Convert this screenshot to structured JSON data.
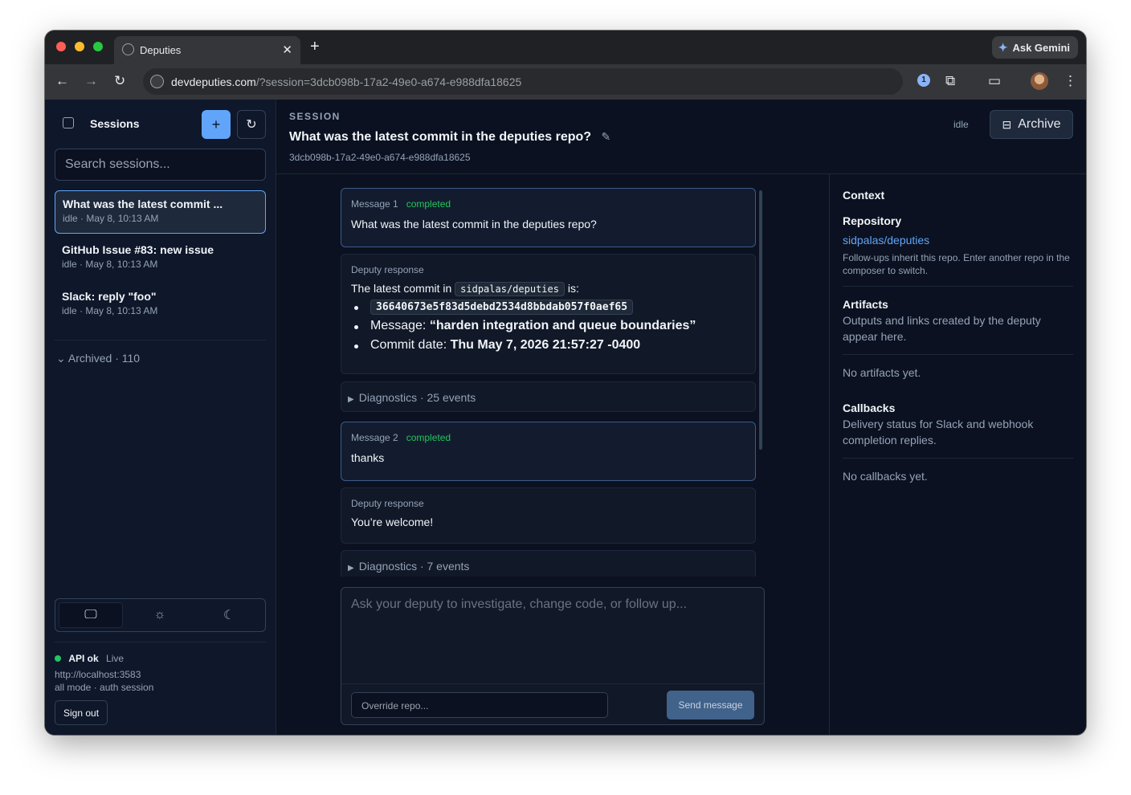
{
  "browser": {
    "tab_title": "Deputies",
    "gemini_label": "Ask Gemini",
    "url_host": "devdeputies.com",
    "url_path": "/?session=3dcb098b-17a2-49e0-a674-e988dfa18625"
  },
  "sidebar": {
    "title": "Sessions",
    "search_placeholder": "Search sessions...",
    "sessions": [
      {
        "title": "What was the latest commit ...",
        "meta": "idle · May 8, 10:13 AM"
      },
      {
        "title": "GitHub Issue #83: new issue",
        "meta": "idle · May 8, 10:13 AM"
      },
      {
        "title": "Slack: reply \"foo\"",
        "meta": "idle · May 8, 10:13 AM"
      }
    ],
    "archived": "Archived · 110",
    "api_status": "API ok",
    "api_live": "Live",
    "api_url": "http://localhost:3583",
    "mode": "all mode · auth session",
    "sign_out": "Sign out"
  },
  "header": {
    "eyebrow": "SESSION",
    "title": "What was the latest commit in the deputies repo?",
    "session_id": "3dcb098b-17a2-49e0-a674-e988dfa18625",
    "status": "idle",
    "archive": "Archive"
  },
  "messages": {
    "m1_label": "Message 1",
    "m1_status": "completed",
    "m1_text": "What was the latest commit in the deputies repo?",
    "r1_label": "Deputy response",
    "r1_intro_a": "The latest commit in",
    "r1_repo": "sidpalas/deputies",
    "r1_intro_b": "is:",
    "r1_sha": "36640673e5f83d5debd2534d8bbdab057f0aef65",
    "r1_msg_label": "Message:",
    "r1_msg": "“harden integration and queue boundaries”",
    "r1_date_label": "Commit date:",
    "r1_date": "Thu May 7, 2026 21:57:27 -0400",
    "d1": "Diagnostics · 25 events",
    "m2_label": "Message 2",
    "m2_status": "completed",
    "m2_text": "thanks",
    "r2_label": "Deputy response",
    "r2_text": "You’re welcome!",
    "d2": "Diagnostics · 7 events"
  },
  "composer": {
    "placeholder": "Ask your deputy to investigate, change code, or follow up...",
    "override_placeholder": "Override repo...",
    "send": "Send message"
  },
  "context": {
    "title": "Context",
    "repo_heading": "Repository",
    "repo_link": "sidpalas/deputies",
    "repo_note": "Follow-ups inherit this repo. Enter another repo in the composer to switch.",
    "artifacts_heading": "Artifacts",
    "artifacts_desc": "Outputs and links created by the deputy appear here.",
    "artifacts_empty": "No artifacts yet.",
    "callbacks_heading": "Callbacks",
    "callbacks_desc": "Delivery status for Slack and webhook completion replies.",
    "callbacks_empty": "No callbacks yet."
  },
  "colors": {
    "accent": "#60a5fa",
    "success": "#22c55e",
    "background": "#0b1120"
  }
}
